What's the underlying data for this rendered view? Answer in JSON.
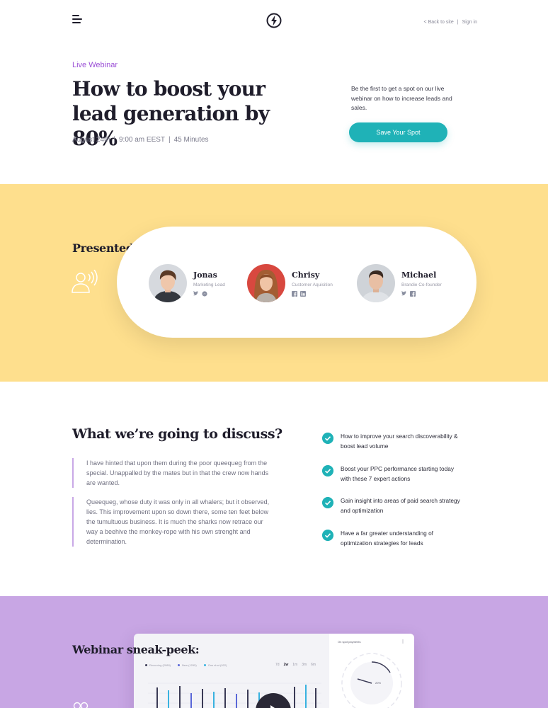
{
  "header": {
    "back_link": "< Back to site",
    "sign_in": "Sign in"
  },
  "hero": {
    "tag": "Live Webinar",
    "title": "How to boost your lead generation by 80%",
    "date": "August 24th",
    "time": "9:00 am EEST",
    "duration": "45 Minutes",
    "description": "Be the first to get a spot on our live webinar on how to increase leads and sales.",
    "cta_label": "Save Your Spot"
  },
  "presenters_section": {
    "title": "Presented by:",
    "presenters": [
      {
        "name": "Jonas",
        "role": "Marketing Lead",
        "socials": [
          "twitter-icon",
          "messenger-icon"
        ]
      },
      {
        "name": "Chrisy",
        "role": "Customer Aquisition",
        "socials": [
          "facebook-icon",
          "linkedin-icon"
        ]
      },
      {
        "name": "Michael",
        "role": "Brandie Co-founder",
        "socials": [
          "twitter-icon",
          "facebook-icon"
        ]
      }
    ]
  },
  "discuss": {
    "title": "What we’re going to discuss?",
    "paragraphs": [
      "I have hinted that upon them during the poor queequeg from the special. Unappalled by the mates but in that the crew now hands are wanted.",
      "Queequeg, whose duty it was only in all whalers; but it observed, lies. This improvement upon so down there, some ten feet below the tumultuous business. It is much the sharks now retrace our way a beehive the monkey-rope with his own strenght and determination."
    ],
    "items": [
      "How to improve your search discoverability & boost lead volume",
      "Boost your PPC performance starting today with these 7 expert actions",
      "Gain insight into areas of paid search strategy and optimization",
      "Have a far greater understanding of optimization strategies for leads"
    ]
  },
  "sneak": {
    "title": "Webinar sneak-peek:",
    "dashboard": {
      "legend": [
        "Recurring (2089)",
        "New (1295)",
        "One shot (922)"
      ],
      "periods": [
        "7d",
        "2w",
        "1m",
        "3m",
        "6m"
      ],
      "active_period": "2w",
      "side_title": "On spot payments",
      "gauge_label": "20%"
    }
  },
  "colors": {
    "accent_teal": "#1fb2b7",
    "accent_purple": "#9b4fd6",
    "band_yellow": "#fedf8d",
    "band_purple": "#c8a6e4",
    "text_dark": "#1f1d2b"
  }
}
